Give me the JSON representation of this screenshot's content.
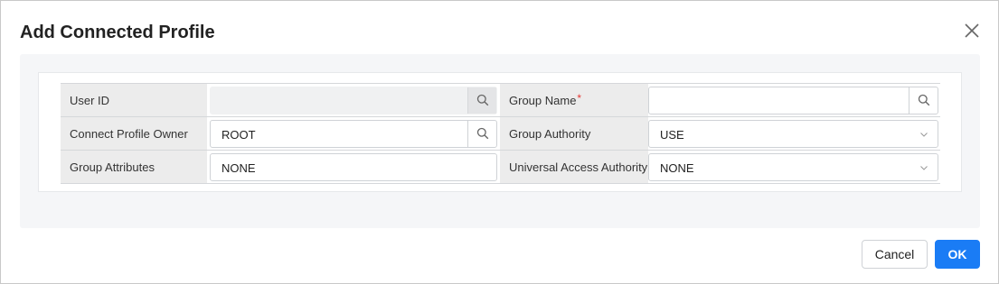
{
  "dialog": {
    "title": "Add Connected Profile",
    "close_icon": "close-icon"
  },
  "form": {
    "rows": [
      {
        "left_label": "User ID",
        "left_value": "",
        "right_label": "Group Name",
        "right_required_mark": "*",
        "right_value": ""
      },
      {
        "left_label": "Connect Profile Owner",
        "left_value": "ROOT",
        "right_label": "Group Authority",
        "right_value": "USE"
      },
      {
        "left_label": "Group Attributes",
        "left_value": "NONE",
        "right_label": "Universal Access Authority",
        "right_value": "NONE"
      }
    ]
  },
  "footer": {
    "cancel_label": "Cancel",
    "ok_label": "OK"
  },
  "colors": {
    "primary": "#1a7cf5",
    "required": "#e53935",
    "label_bg": "#ececec",
    "panel_bg": "#f5f6f8"
  }
}
